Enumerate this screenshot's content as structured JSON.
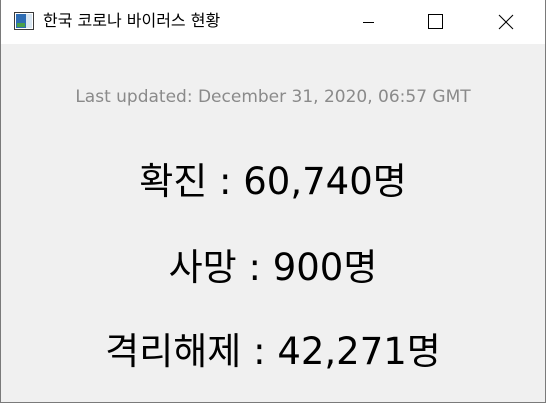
{
  "window": {
    "title": "한국 코로나 바이러스 현황",
    "controls": {
      "minimize": "minimize-icon",
      "maximize": "maximize-icon",
      "close": "close-icon"
    }
  },
  "main": {
    "last_updated": "Last updated: December 31, 2020, 06:57 GMT",
    "stats": {
      "confirmed": "확진 : 60,740명",
      "deaths": "사망 : 900명",
      "released": "격리해제 : 42,271명"
    }
  }
}
